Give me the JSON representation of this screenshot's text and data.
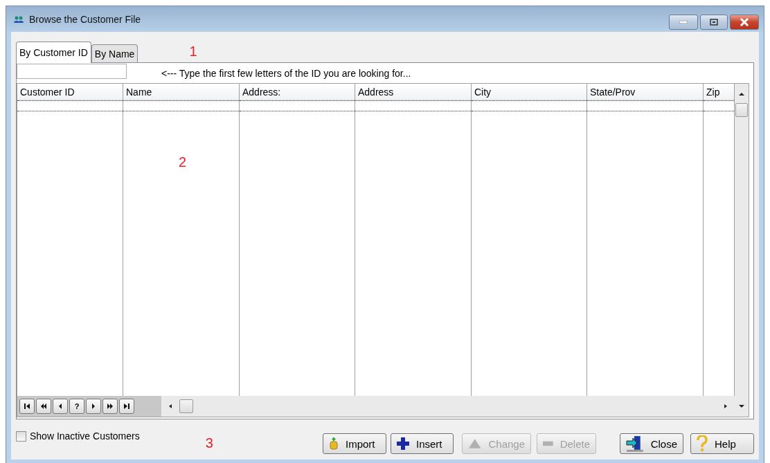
{
  "window": {
    "title": "Browse the Customer File"
  },
  "tabs": [
    {
      "label": "By Customer ID",
      "selected": true
    },
    {
      "label": "By Name",
      "selected": false
    }
  ],
  "annotations": [
    "1",
    "2",
    "3"
  ],
  "search": {
    "hint": "<--- Type the first few letters of the ID you are looking for..."
  },
  "table": {
    "columns": [
      "Customer ID",
      "Name",
      "Address:",
      "Address",
      "City",
      "State/Prov",
      "Zip"
    ]
  },
  "navigator": [
    {
      "kind": "first"
    },
    {
      "kind": "prev-page"
    },
    {
      "kind": "prev"
    },
    {
      "kind": "query",
      "label": "?"
    },
    {
      "kind": "next"
    },
    {
      "kind": "next-page"
    },
    {
      "kind": "last"
    }
  ],
  "show_inactive": {
    "label": "Show Inactive Customers",
    "checked": false
  },
  "buttons": [
    {
      "kind": "import",
      "label": "Import",
      "disabled": false
    },
    {
      "kind": "insert",
      "label": "Insert",
      "disabled": false
    },
    {
      "kind": "change",
      "label": "Change",
      "disabled": true
    },
    {
      "kind": "delete",
      "label": "Delete",
      "disabled": true
    },
    {
      "kind": "close",
      "label": "Close",
      "disabled": false
    },
    {
      "kind": "help",
      "label": "Help",
      "disabled": false
    }
  ]
}
